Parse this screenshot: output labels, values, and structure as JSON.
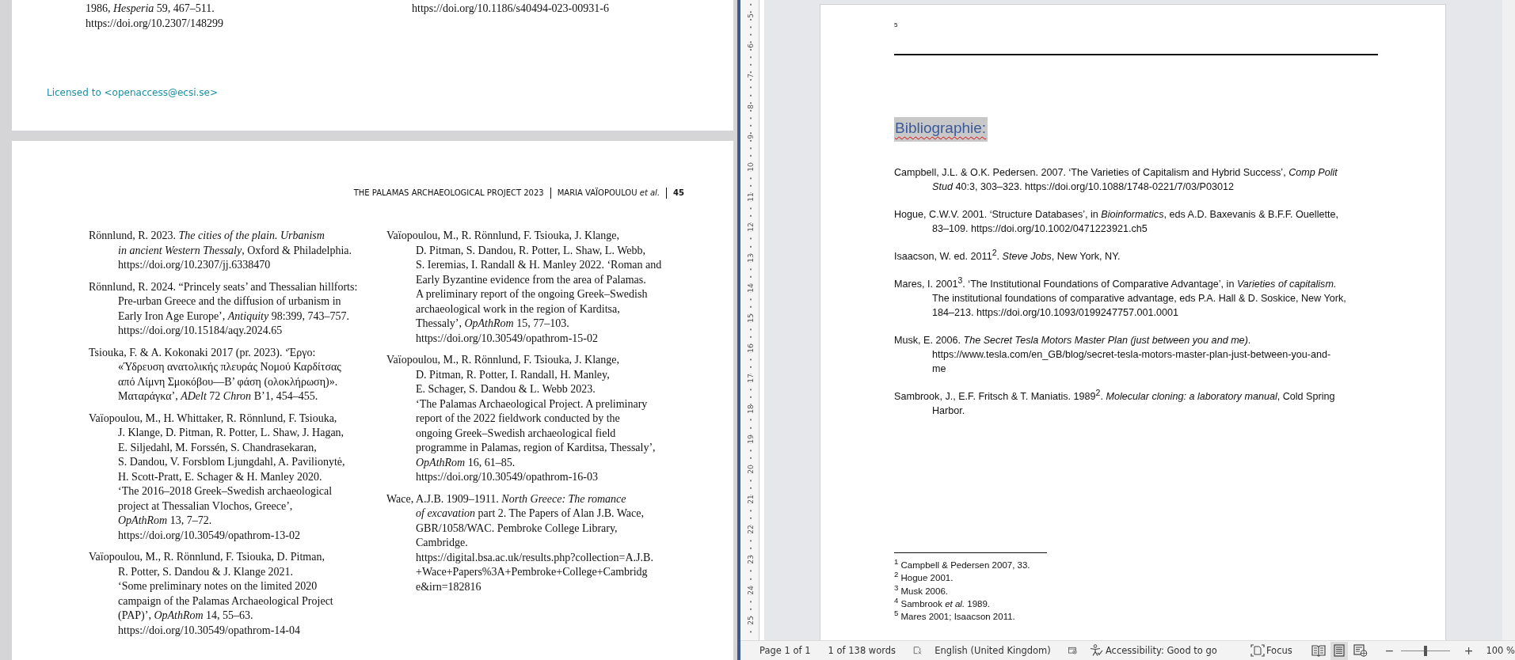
{
  "pdf_viewer": {
    "page_1": {
      "column_1_lines": [
        "1986, *Hesperia* 59, 467–511.",
        "https://doi.org/10.2307/148299"
      ],
      "column_2_lines": [
        "https://doi.org/10.1186/s40494-023-00931-6"
      ],
      "license": "Licensed to <openaccess@ecsi.se>"
    },
    "page_2": {
      "running_header": [
        "THE PALAMAS ARCHAEOLOGICAL PROJECT 2023",
        "MARIA VAÏOPOULOU *et al.*",
        "45"
      ],
      "column_1": [
        {
          "lines": [
            "Rönnlund, R. 2023. *The cities of the plain. Urbanism*",
            "*in ancient Western Thessaly*, Oxford & Philadelphia.",
            "https://doi.org/10.2307/jj.6338470"
          ]
        },
        {
          "lines": [
            "Rönnlund, R. 2024. “Princely seats’ and Thessalian hillforts:",
            "Pre-urban Greece and the diffusion of urbanism in",
            "Early Iron Age Europe’, *Antiquity* 98:399, 743–757.",
            "https://doi.org/10.15184/aqy.2024.65"
          ]
        },
        {
          "lines": [
            "Tsiouka, F. & A. Kokonaki 2017 (pr. 2023). ‘Έργο:",
            "«Ύδρευση ανατολικής πλευράς Νομού Καρδίτσας",
            "από Λίμνη Σμοκόβου—Β’ φάση (ολοκλήρωση)».",
            "Ματαράγκα’, *ADelt* 72 *Chron* B’1, 454–455."
          ]
        },
        {
          "lines": [
            "Vaïopoulou, M., H. Whittaker, R. Rönnlund, F. Tsiouka,",
            "J. Klange, D. Pitman, R. Potter, L. Shaw, J. Hagan,",
            "E. Siljedahl, M. Forssén, S. Chandrasekaran,",
            "S. Dandou, V. Forsblom Ljungdahl, A. Pavilionytė,",
            "H. Scott-Pratt, E. Schager & H. Manley 2020.",
            "‘The 2016–2018 Greek–Swedish archaeological",
            "project at Thessalian Vlochos, Greece’,",
            "*OpAthRom* 13, 7–72.",
            "https://doi.org/10.30549/opathrom-13-02"
          ]
        },
        {
          "lines": [
            "Vaïopoulou, M., R. Rönnlund, F. Tsiouka, D. Pitman,",
            "R. Potter, S. Dandou & J. Klange 2021.",
            "‘Some preliminary notes on the limited 2020",
            "campaign of the Palamas Archaeological Project",
            "(PAP)’, *OpAthRom* 14, 55–63.",
            "https://doi.org/10.30549/opathrom-14-04"
          ]
        }
      ],
      "column_2": [
        {
          "lines": [
            "Vaïopoulou, M., R. Rönnlund, F. Tsiouka, J. Klange,",
            "D. Pitman, S. Dandou, R. Potter, L. Shaw, L. Webb,",
            "S. Ieremias, I. Randall & H. Manley 2022. ‘Roman and",
            "Early Byzantine evidence from the area of Palamas.",
            "A preliminary report of the ongoing Greek–Swedish",
            "archaeological work in the region of Karditsa,",
            "Thessaly’, *OpAthRom* 15, 77–103.",
            "https://doi.org/10.30549/opathrom-15-02"
          ]
        },
        {
          "lines": [
            "Vaïopoulou, M., R. Rönnlund, F. Tsiouka, J. Klange,",
            "D. Pitman, R. Potter, I. Randall, H. Manley,",
            "E. Schager, S. Dandou & L. Webb 2023.",
            "‘The Palamas  Archaeological Project. A preliminary",
            "report of the 2022 fieldwork conducted by the",
            "ongoing Greek–Swedish archaeological field",
            "programme in Palamas, region of Karditsa, Thessaly’,",
            "*OpAthRom* 16, 61–85.",
            "https://doi.org/10.30549/opathrom-16-03"
          ]
        },
        {
          "lines": [
            "Wace, A.J.B. 1909–1911. *North Greece: The romance*",
            "*of excavation* part 2. The Papers of Alan J.B. Wace,",
            "GBR/1058/WAC. Pembroke College Library,",
            "Cambridge.",
            "https://digital.bsa.ac.uk/results.php?collection=A.J.B.",
            "+Wace+Papers%3A+Pembroke+College+Cambridg",
            "e&irn=182816"
          ]
        }
      ]
    }
  },
  "word": {
    "ruler": [
      "5",
      "6",
      "7",
      "8",
      "9",
      "10",
      "11",
      "12",
      "13",
      "14",
      "15",
      "16",
      "17",
      "18",
      "19",
      "20",
      "21",
      "22",
      "23",
      "24",
      "25"
    ],
    "footnote_mark": "5",
    "heading": {
      "text": "Bibliographie:",
      "highlighted": true,
      "misspelled": true
    },
    "entries": [
      {
        "lines": [
          "Campbell, J.L. & O.K. Pedersen. 2007. ‘The Varieties of Capitalism and Hybrid Success’, *Comp Polit*",
          "*Stud* 40:3, 303–323. https://doi.org/10.1088/1748-0221/7/03/P03012"
        ]
      },
      {
        "lines": [
          "Hogue, C.W.V. 2001. ‘Structure Databases’, in *Bioinformatics*, eds A.D. Baxevanis & B.F.F. Ouellette,",
          "83–109. https://doi.org/10.1002/0471223921.ch5"
        ]
      },
      {
        "lines": [
          "Isaacson, W. ed. 2011$^{2}$. *Steve Jobs*, New York, NY."
        ]
      },
      {
        "lines": [
          "Mares, I. 2001$^{3}$. ‘The Institutional Foundations of Comparative Advantage’, in *Varieties of capitalism.*",
          "The institutional foundations of comparative advantage, eds P.A. Hall & D. Soskice, New York,",
          "184–213. https://doi.org/10.1093/0199247757.001.0001"
        ]
      },
      {
        "lines": [
          "Musk, E. 2006. *The Secret Tesla Motors Master Plan (just between you and me)*.",
          "https://www.tesla.com/en_GB/blog/secret-tesla-motors-master-plan-just-between-you-and-",
          "me"
        ]
      },
      {
        "lines": [
          "Sambrook, J., E.F. Fritsch & T. Maniatis. 1989$^{2}$. *Molecular cloning: a laboratory manual*, Cold Spring",
          "Harbor."
        ]
      }
    ],
    "footnotes": [
      "$^{1}$ Campbell & Pedersen 2007, 33.",
      "$^{2}$ Hogue 2001.",
      "$^{3}$ Musk 2006.",
      "$^{4}$ Sambrook *et al.* 1989.",
      "$^{5}$ Mares 2001; Isaacson 2011."
    ],
    "status_bar": {
      "page": "Page 1 of 1",
      "words": "1 of 138 words",
      "language": "English (United Kingdom)",
      "accessibility": "Accessibility: Good to go",
      "focus": "Focus",
      "views": [
        {
          "kind": "read",
          "selected": false
        },
        {
          "kind": "print",
          "selected": true
        },
        {
          "kind": "web",
          "selected": false
        }
      ],
      "zoom_minus": "−",
      "zoom_plus": "+",
      "zoom": {
        "level": 0.5
      },
      "zoom_value": "100 %"
    }
  }
}
